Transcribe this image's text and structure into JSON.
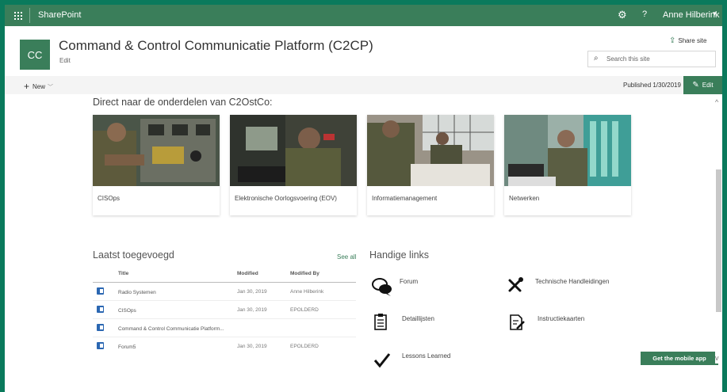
{
  "suitebar": {
    "app_name": "SharePoint",
    "help": "?",
    "user": "Anne Hilberink",
    "icons": [
      "waffle-icon",
      "gear-icon",
      "chevron-down-icon"
    ]
  },
  "header": {
    "logo_initials": "CC",
    "title": "Command & Control Communicatie Platform (C2CP)",
    "edit_link": "Edit",
    "share_label": "Share site",
    "search_placeholder": "Search this site"
  },
  "command_bar": {
    "new_label": "New",
    "published": "Published 1/30/2019",
    "edit_label": "Edit"
  },
  "quick_links": {
    "heading": "Direct naar de onderdelen van C2OstCo:",
    "cards": [
      {
        "label": "CISOps"
      },
      {
        "label": "Elektronische Oorlogsvoering (EOV)"
      },
      {
        "label": "Informatiemanagement"
      },
      {
        "label": "Netwerken"
      }
    ]
  },
  "recent": {
    "heading": "Laatst toegevoegd",
    "see_all": "See all",
    "columns": [
      "Title",
      "Modified",
      "Modified By"
    ],
    "rows": [
      {
        "title": "Radio Systemen",
        "modified": "Jan 30, 2019",
        "by": "Anne Hilberink"
      },
      {
        "title": "CISOps",
        "modified": "Jan 30, 2019",
        "by": "EPOLDERD"
      },
      {
        "title": "Command & Control Communicatie Platform...",
        "modified": "",
        "by": ""
      },
      {
        "title": "Forum5",
        "modified": "Jan 30, 2019",
        "by": "EPOLDERD"
      }
    ]
  },
  "handy_links": {
    "heading": "Handige links",
    "items": [
      {
        "label": "Forum",
        "icon": "chat-bubbles-icon"
      },
      {
        "label": "Technische Handleidingen",
        "icon": "tools-icon"
      },
      {
        "label": "Detaillijsten",
        "icon": "checklist-icon"
      },
      {
        "label": "Instructiekaarten",
        "icon": "document-edit-icon"
      },
      {
        "label": "Lessons Learned",
        "icon": "checkmark-icon"
      }
    ]
  },
  "mobile_app": "Get the mobile app",
  "colors": {
    "brand": "#3a7e5a",
    "border": "#0a7a5c"
  }
}
